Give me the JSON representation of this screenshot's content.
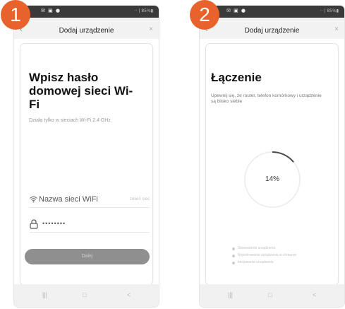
{
  "badges": {
    "first": "1",
    "second": "2"
  },
  "status_bar": {
    "icons": "✉ ▣ ●",
    "right": "·· | 85%▮"
  },
  "screen1": {
    "title": "Dodaj urządzenie",
    "heading": "Wpisz hasło domowej sieci Wi-Fi",
    "subtitle": "Działa tylko w sieciach Wi-Fi 2.4 GHz",
    "wifi_name": "Nazwa sieci WiFi",
    "wifi_change": "zmień sieć",
    "password_mask": "••••••••",
    "next_button": "Dalej"
  },
  "screen2": {
    "title": "Dodaj urządzenie",
    "heading": "Łączenie",
    "subtitle": "Upewnij się, że router, telefon komórkowy i urządzenie są blisko siebie",
    "progress_text": "14%",
    "progress_value": 0.14,
    "steps": [
      "Skanowanie urządzenia",
      "Rejestrowanie urządzenia w chmurze",
      "Inicjowanie urządzenia"
    ]
  },
  "nav": {
    "recent": "|||",
    "home": "□",
    "back": "<"
  },
  "colors": {
    "badge": "#e8622c",
    "button": "#8f8f8f"
  }
}
